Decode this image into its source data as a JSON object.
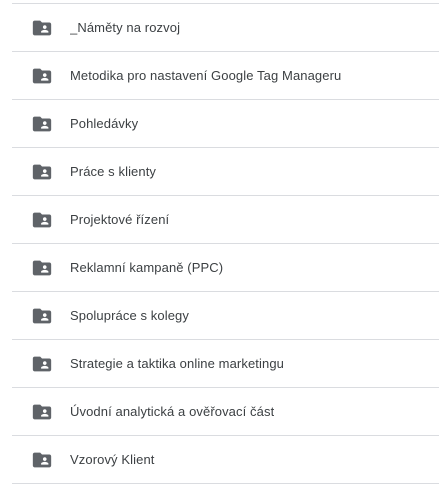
{
  "folders": [
    {
      "name": "_Náměty na rozvoj",
      "icon": "shared-folder-icon"
    },
    {
      "name": "Metodika pro nastavení Google Tag Manageru",
      "icon": "shared-folder-icon"
    },
    {
      "name": "Pohledávky",
      "icon": "shared-folder-icon"
    },
    {
      "name": "Práce s klienty",
      "icon": "shared-folder-icon"
    },
    {
      "name": "Projektové řízení",
      "icon": "shared-folder-icon"
    },
    {
      "name": "Reklamní kampaně (PPC)",
      "icon": "shared-folder-icon"
    },
    {
      "name": "Spolupráce s kolegy",
      "icon": "shared-folder-icon"
    },
    {
      "name": "Strategie a taktika online marketingu",
      "icon": "shared-folder-icon"
    },
    {
      "name": "Úvodní analytická a ověřovací část",
      "icon": "shared-folder-icon"
    },
    {
      "name": "Vzorový Klient",
      "icon": "shared-folder-icon"
    }
  ],
  "colors": {
    "icon": "#5f6368",
    "text": "#3c4043",
    "divider": "#dadce0"
  }
}
